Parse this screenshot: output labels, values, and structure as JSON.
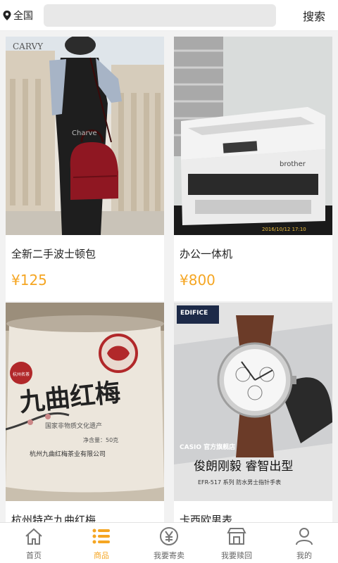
{
  "header": {
    "location_icon": "map-pin-icon",
    "location_label": "全国",
    "search_placeholder": "",
    "search_button": "搜索"
  },
  "products": [
    {
      "title": "全新二手波士顿包",
      "price": "¥125",
      "photo": {
        "logo_text": "CARVY",
        "bag_brand": "Charve"
      }
    },
    {
      "title": "办公一体机",
      "price": "¥800",
      "photo": {
        "brand": "brother",
        "timestamp": "2016/10/12  17:10"
      }
    },
    {
      "title": "杭州特产九曲红梅",
      "price": "",
      "photo": {
        "big_text": "九曲红梅",
        "sub_text": "国家非物质文化遗产",
        "net_weight": "净含量：50克",
        "company": "杭州九曲红梅茶业有限公司",
        "badge": "杭州名茶"
      }
    },
    {
      "title": "卡西欧男表",
      "price": "",
      "photo": {
        "brand": "EDIFICE",
        "sub_brand": "CASIO 官方旗舰店",
        "slogan": "俊朗刚毅 睿智出型",
        "model": "EFR-517 系列 防水男士指针手表"
      }
    }
  ],
  "tabs": [
    {
      "label": "首页",
      "icon": "home-icon",
      "active": false
    },
    {
      "label": "商品",
      "icon": "list-icon",
      "active": true
    },
    {
      "label": "我要寄卖",
      "icon": "yen-coin-icon",
      "active": false
    },
    {
      "label": "我要赎回",
      "icon": "shop-icon",
      "active": false
    },
    {
      "label": "我的",
      "icon": "user-icon",
      "active": false
    }
  ],
  "colors": {
    "accent": "#f5a623",
    "text": "#222222",
    "background": "#f2f2f2"
  }
}
